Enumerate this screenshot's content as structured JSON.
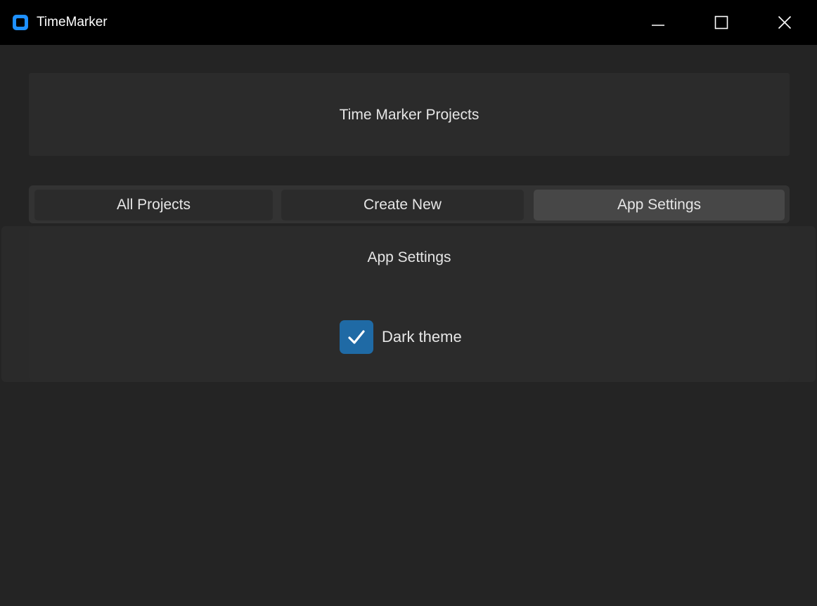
{
  "window": {
    "title": "TimeMarker",
    "controls": [
      "minimize-icon",
      "maximize-icon",
      "close-icon"
    ]
  },
  "header": {
    "title": "Time Marker Projects"
  },
  "tabs": [
    {
      "label": "All Projects",
      "selected": false
    },
    {
      "label": "Create New",
      "selected": false
    },
    {
      "label": "App Settings",
      "selected": true
    }
  ],
  "settings": {
    "title": "App Settings",
    "dark_theme": {
      "label": "Dark theme",
      "checked": true
    }
  },
  "colors": {
    "titlebar": "#000000",
    "background": "#242424",
    "panel": "#2b2b2b",
    "tab_selected": "#474747",
    "accent": "#1f6aa5",
    "app_icon": "#1e90ff"
  }
}
